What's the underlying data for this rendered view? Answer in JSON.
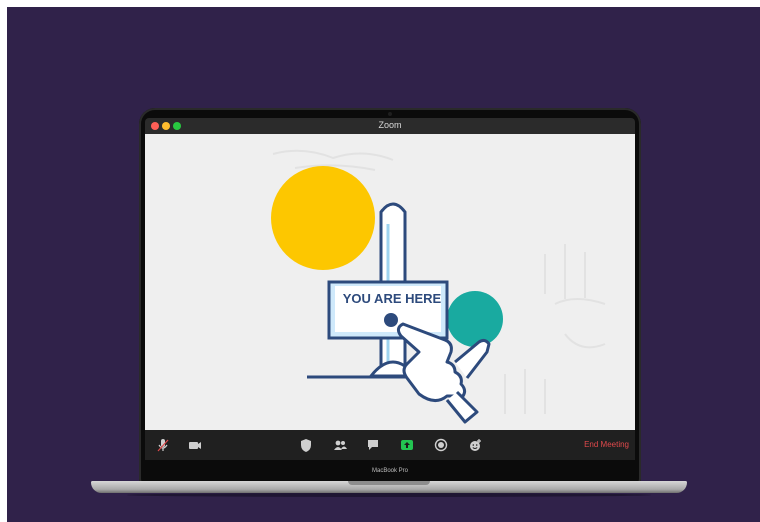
{
  "window": {
    "title": "Zoom",
    "traffic_lights": {
      "close": "#fe5f57",
      "minimize": "#febc2e",
      "zoom": "#28c840"
    }
  },
  "share": {
    "sign_text": "YOU ARE HERE",
    "colors": {
      "yellow": "#fdc700",
      "teal": "#19aaa0",
      "navy": "#2d4a7c",
      "screen_bg": "#efefef"
    }
  },
  "toolbar": {
    "mic_icon": "mic-icon",
    "video_icon": "video-camera-icon",
    "security_icon": "shield-icon",
    "participants_icon": "participants-icon",
    "chat_icon": "chat-icon",
    "share_icon": "share-screen-icon",
    "record_icon": "record-icon",
    "reactions_icon": "reactions-icon",
    "end_label": "End Meeting"
  },
  "device": {
    "label": "MacBook Pro",
    "background": "#30224a"
  }
}
